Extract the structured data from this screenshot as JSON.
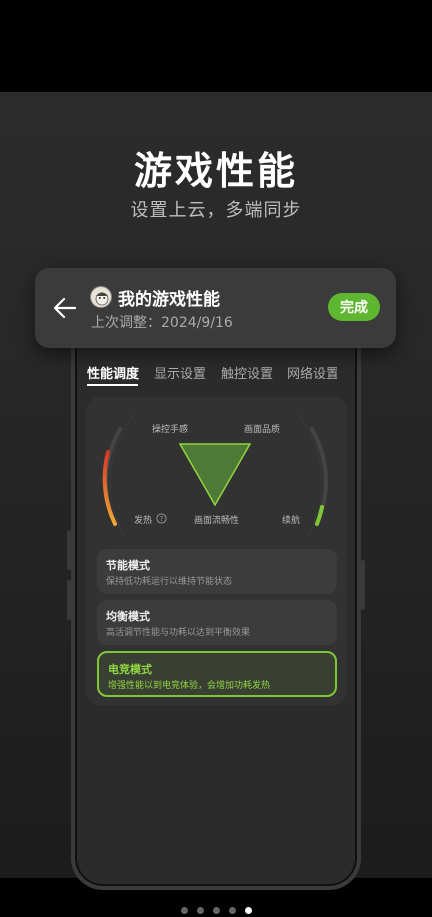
{
  "hero": {
    "title": "游戏性能",
    "subtitle": "设置上云，多端同步"
  },
  "header": {
    "title": "我的游戏性能",
    "last_adjusted": "上次调整：2024/9/16",
    "done_label": "完成",
    "back_icon": "back-arrow-icon"
  },
  "tabs": [
    {
      "label": "性能调度",
      "active": true
    },
    {
      "label": "显示设置",
      "active": false
    },
    {
      "label": "触控设置",
      "active": false
    },
    {
      "label": "网络设置",
      "active": false
    }
  ],
  "gauge": {
    "top_left": "操控手感",
    "top_right": "画面品质",
    "bottom_left": "发热",
    "bottom_center": "画面流畅性",
    "bottom_right": "续航",
    "info_icon": "info-icon"
  },
  "modes": [
    {
      "title": "节能模式",
      "desc": "保持低功耗运行以维持节能状态",
      "selected": false
    },
    {
      "title": "均衡模式",
      "desc": "高活调节性能与功耗以达到平衡效果",
      "selected": false
    },
    {
      "title": "电竞模式",
      "desc": "增强性能以到电竞体验，会增加功耗发热",
      "selected": true
    }
  ],
  "pager": {
    "count": 5,
    "active_index": 4
  },
  "colors": {
    "accent": "#5fb731",
    "selected_border": "#7ec832"
  }
}
